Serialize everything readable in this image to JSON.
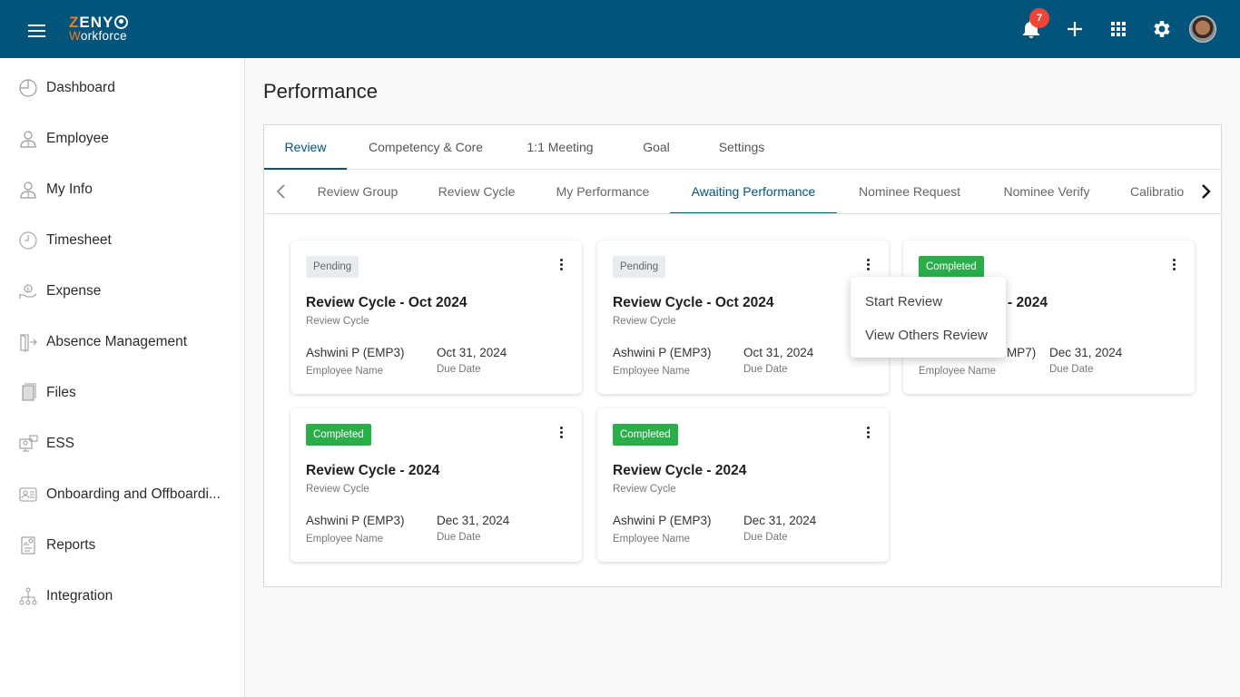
{
  "header": {
    "logo_line1_accent": "Z",
    "logo_line1_rest": "ENY",
    "logo_line2_accent": "W",
    "logo_line2_rest": "orkforce",
    "notification_count": "7",
    "colors": {
      "bar": "#03547a",
      "accent": "#f07b27",
      "badge": "#f04438"
    },
    "icons": [
      "menu-icon",
      "bell-icon",
      "plus-icon",
      "apps-grid-icon",
      "gear-icon",
      "avatar"
    ]
  },
  "sidebar": {
    "items": [
      {
        "label": "Dashboard",
        "icon": "dashboard-pie-icon"
      },
      {
        "label": "Employee",
        "icon": "employee-icon"
      },
      {
        "label": "My Info",
        "icon": "my-info-icon"
      },
      {
        "label": "Timesheet",
        "icon": "clock-icon"
      },
      {
        "label": "Expense",
        "icon": "expense-hand-coin-icon"
      },
      {
        "label": "Absence Management",
        "icon": "door-exit-icon"
      },
      {
        "label": "Files",
        "icon": "files-icon"
      },
      {
        "label": "ESS",
        "icon": "ess-monitor-chat-icon"
      },
      {
        "label": "Onboarding and Offboardi...",
        "icon": "id-card-icon"
      },
      {
        "label": "Reports",
        "icon": "report-icon"
      },
      {
        "label": "Integration",
        "icon": "hierarchy-icon"
      }
    ]
  },
  "page": {
    "title": "Performance",
    "primary_tabs": [
      {
        "label": "Review",
        "active": true
      },
      {
        "label": "Competency & Core",
        "active": false
      },
      {
        "label": "1:1 Meeting",
        "active": false
      },
      {
        "label": "Goal",
        "active": false
      },
      {
        "label": "Settings",
        "active": false
      }
    ],
    "secondary_tabs": [
      {
        "label": "Review Group",
        "active": false
      },
      {
        "label": "Review Cycle",
        "active": false
      },
      {
        "label": "My Performance",
        "active": false
      },
      {
        "label": "Awaiting Performance",
        "active": true
      },
      {
        "label": "Nominee Request",
        "active": false
      },
      {
        "label": "Nominee Verify",
        "active": false
      },
      {
        "label": "Calibratio",
        "active": false
      }
    ],
    "cards": [
      {
        "status": "Pending",
        "title": "Review Cycle - Oct 2024",
        "subtitle": "Review Cycle",
        "employee": "Ashwini P (EMP3)",
        "employee_label": "Employee Name",
        "due_date": "Oct 31, 2024",
        "due_label": "Due Date"
      },
      {
        "status": "Pending",
        "title": "Review Cycle - Oct 2024",
        "subtitle": "Review Cycle",
        "employee": "Ashwini P (EMP3)",
        "employee_label": "Employee Name",
        "due_date": "Oct 31, 2024",
        "due_label": "Due Date"
      },
      {
        "status": "Completed",
        "title": "- 2024",
        "subtitle": "",
        "employee": "MP7)",
        "employee_label": "Employee Name",
        "due_date": "Dec 31, 2024",
        "due_label": "Due Date"
      },
      {
        "status": "Completed",
        "title": "Review Cycle - 2024",
        "subtitle": "Review Cycle",
        "employee": "Ashwini P (EMP3)",
        "employee_label": "Employee Name",
        "due_date": "Dec 31, 2024",
        "due_label": "Due Date"
      },
      {
        "status": "Completed",
        "title": "Review Cycle - 2024",
        "subtitle": "Review Cycle",
        "employee": "Ashwini P (EMP3)",
        "employee_label": "Employee Name",
        "due_date": "Dec 31, 2024",
        "due_label": "Due Date"
      }
    ],
    "context_menu": {
      "items": [
        "Start Review",
        "View Others Review"
      ]
    },
    "colors": {
      "active_tab": "#03547a",
      "pending_bg": "#e8ebf0",
      "completed_bg": "#2aae4a"
    }
  }
}
